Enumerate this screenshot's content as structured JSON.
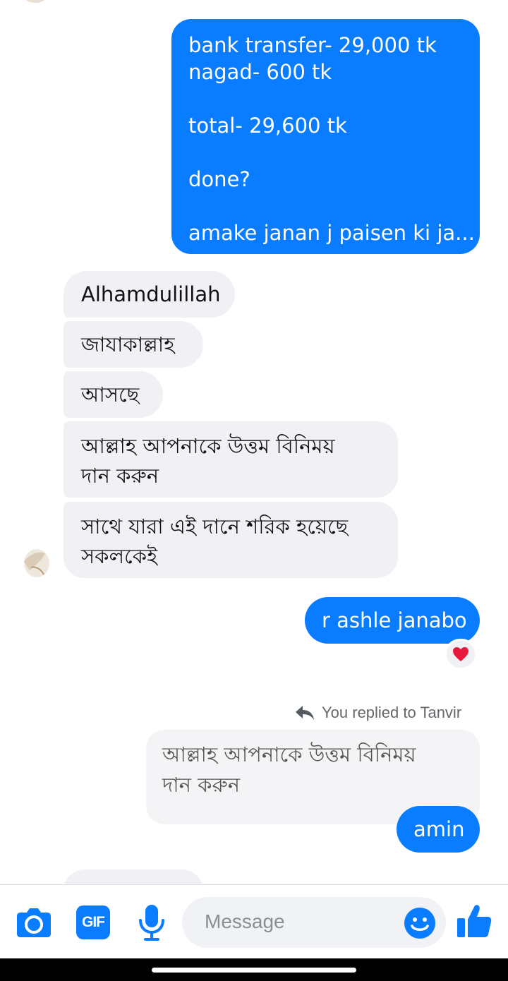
{
  "colors": {
    "accent": "#0a7cff",
    "incoming_bubble": "#f0f0f5",
    "heart": "#e8193c"
  },
  "outgoing_first": {
    "lines": [
      "bank transfer- 29,000 tk",
      "nagad- 600 tk",
      "",
      "total- 29,600 tk",
      "",
      "done?",
      "",
      "amake janan j paisen ki ja..."
    ]
  },
  "incoming": [
    {
      "text": "Alhamdulillah"
    },
    {
      "text": "জাযাকাল্লাহ"
    },
    {
      "text": "আসছে"
    },
    {
      "line1": "আল্লাহ আপনাকে উত্তম বিনিময়",
      "line2": "দান করুন"
    },
    {
      "line1": "সাথে যারা এই দানে শরিক হয়েছে",
      "line2": "সকলকেই"
    }
  ],
  "outgoing_second": {
    "text": "r ashle janabo",
    "reaction_icon": "heart-icon"
  },
  "reply": {
    "label": "You replied to Tanvir",
    "quoted_line1": "আল্লাহ আপনাকে উত্তম বিনিময়",
    "quoted_line2": "দান করুন",
    "text": "amin"
  },
  "composer": {
    "placeholder": "Message",
    "icons": [
      "camera-icon",
      "gif-icon",
      "microphone-icon",
      "emoji-icon",
      "thumbs-up-icon"
    ],
    "gif_label": "GIF"
  }
}
